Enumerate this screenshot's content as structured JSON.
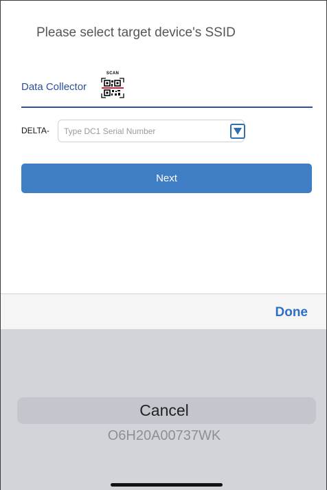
{
  "header": {
    "prompt": "Please select target device's SSID"
  },
  "collector": {
    "label": "Data Collector",
    "scan_label": "SCAN"
  },
  "serial": {
    "prefix": "DELTA-",
    "placeholder": "Type DC1 Serial Number",
    "value": ""
  },
  "actions": {
    "next_label": "Next"
  },
  "toolbar": {
    "done_label": "Done"
  },
  "picker": {
    "selected": "Cancel",
    "options": [
      "O6H20A00737WK"
    ]
  },
  "colors": {
    "accent": "#3f7dc4",
    "link": "#2d6fc4",
    "label_blue": "#2a4fa0",
    "picker_bg": "#d1d4d9"
  },
  "icons": {
    "scan": "qr-code-scan-icon",
    "dropdown": "dropdown-triangle-icon"
  }
}
